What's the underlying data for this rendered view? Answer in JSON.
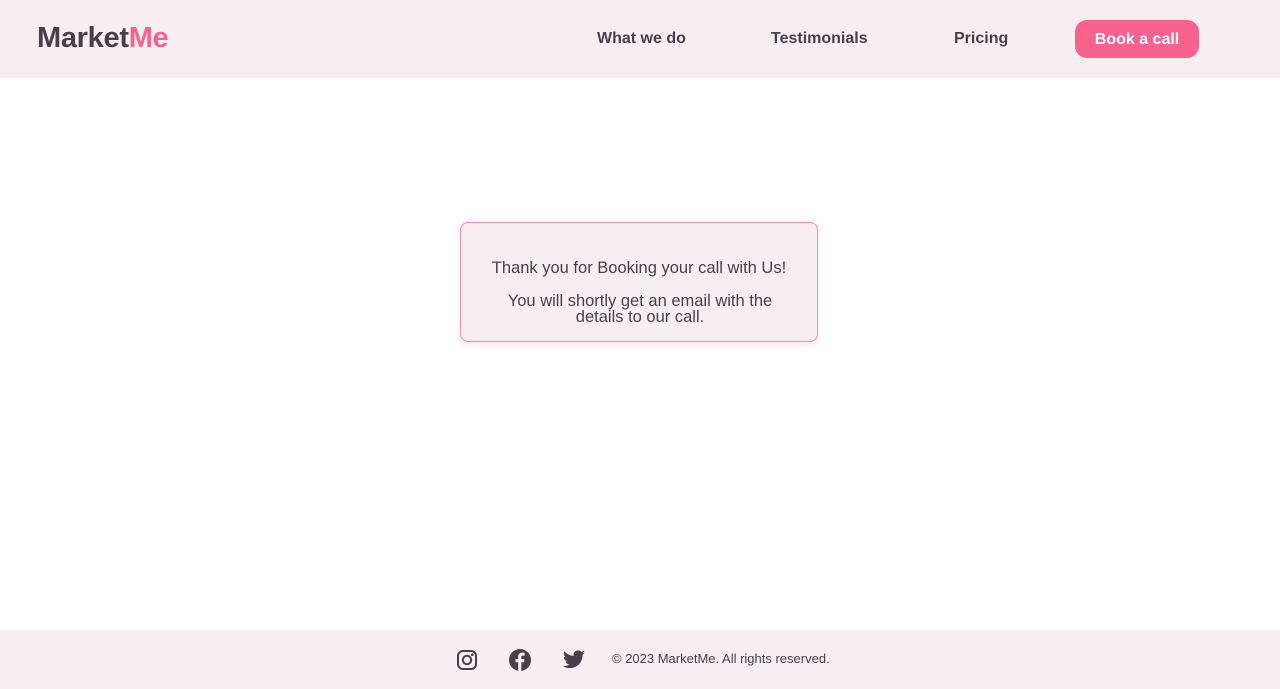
{
  "header": {
    "logo": {
      "part1": "Market",
      "part2": "Me"
    },
    "nav": {
      "what_we_do": "What we do",
      "testimonials": "Testimonials",
      "pricing": "Pricing"
    },
    "cta_label": "Book a call"
  },
  "confirmation": {
    "line1": "Thank you for Booking your call with Us!",
    "line2": "You will shortly get an email with the details to our call."
  },
  "footer": {
    "social_icons": [
      "instagram-icon",
      "facebook-icon",
      "twitter-icon"
    ],
    "copyright": "© 2023 MarketMe. All rights reserved."
  },
  "colors": {
    "accent": "#f7628f",
    "surface": "#f8edf1",
    "text": "#4a3f48",
    "card_border": "#f08db0"
  }
}
